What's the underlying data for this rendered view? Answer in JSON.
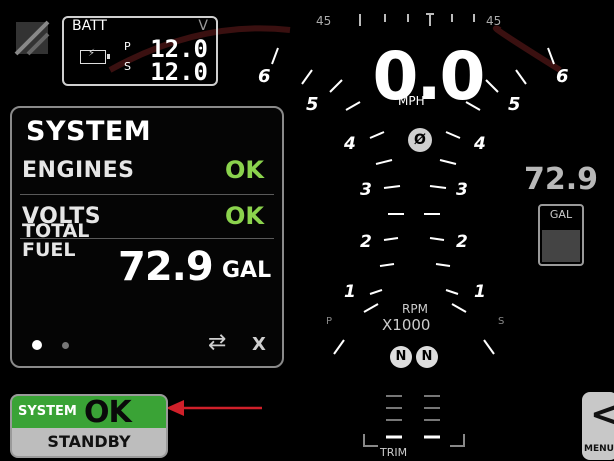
{
  "battery": {
    "title": "BATT",
    "unit": "V",
    "port_label": "P",
    "port_value": "12.0",
    "stbd_label": "S",
    "stbd_value": "12.0"
  },
  "system_panel": {
    "title": "SYSTEM",
    "rows": [
      {
        "label": "ENGINES",
        "value": "OK"
      },
      {
        "label": "VOLTS",
        "value": "OK"
      }
    ],
    "total_fuel_label_1": "TOTAL",
    "total_fuel_label_2": "FUEL",
    "total_fuel_value": "72.9",
    "total_fuel_unit": "GAL",
    "close_label": "X"
  },
  "status_button": {
    "system_label": "SYSTEM",
    "ok_label": "OK",
    "mode_label": "STANDBY"
  },
  "speedometer": {
    "value": "0.0",
    "unit": "MPH",
    "scale_left": [
      "6",
      "5",
      "4",
      "3",
      "2",
      "1"
    ],
    "scale_right": [
      "6",
      "5",
      "4",
      "3",
      "2",
      "1"
    ]
  },
  "tachometer": {
    "label": "RPM",
    "multiplier": "X1000",
    "port": "P",
    "stbd": "S"
  },
  "top_scale": {
    "left": "45",
    "right": "45"
  },
  "gears": {
    "port": "N",
    "stbd": "N"
  },
  "trim": {
    "label": "TRIM"
  },
  "fuel_right": {
    "value": "72.9",
    "unit": "GAL",
    "tank_level": 0.55
  },
  "menu": {
    "label": "MENU",
    "chevron": "<"
  },
  "colors": {
    "ok_green": "#8bd34d",
    "status_green": "#3aa336",
    "arrow_red": "#d0202a"
  }
}
